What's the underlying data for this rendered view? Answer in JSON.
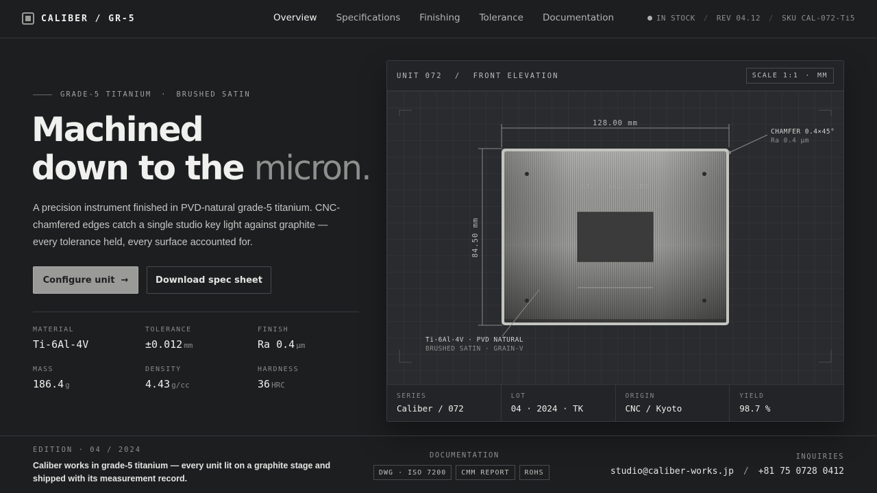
{
  "brand": {
    "name": "CALIBER / GR-5"
  },
  "nav": {
    "links": [
      "Overview",
      "Specifications",
      "Finishing",
      "Tolerance",
      "Documentation"
    ],
    "status": "IN STOCK",
    "sep": "/",
    "rev": "REV 04.12",
    "sku": "SKU CAL-072-Ti5"
  },
  "hero": {
    "eyebrow_a": "GRADE-5 TITANIUM",
    "eyebrow_sep": "·",
    "eyebrow_b": "BRUSHED SATIN",
    "headline_line1": "Machined",
    "headline_line2": "down to the",
    "headline_accent": "micron.",
    "lede": "A precision instrument finished in PVD-natural grade-5 titanium. CNC-chamfered edges catch a single studio key light against graphite — every tolerance held, every surface accounted for.",
    "cta_primary": "Configure unit  →",
    "cta_secondary": "Download spec sheet"
  },
  "specs": [
    {
      "label": "MATERIAL",
      "value": "Ti-6Al-4V",
      "unit": ""
    },
    {
      "label": "TOLERANCE",
      "value": "±0.012",
      "unit": "mm"
    },
    {
      "label": "FINISH",
      "value": "Ra 0.4",
      "unit": "µm"
    },
    {
      "label": "MASS",
      "value": "186.4",
      "unit": "g"
    },
    {
      "label": "DENSITY",
      "value": "4.43",
      "unit": "g/cc"
    },
    {
      "label": "HARDNESS",
      "value": "36",
      "unit": "HRC"
    }
  ],
  "panel": {
    "unit": "UNIT 072",
    "sep": "/",
    "view": "FRONT ELEVATION",
    "scale": "SCALE 1:1",
    "scale_sep": "·",
    "scale_unit": "MM",
    "drawing": {
      "width_dim": "128.00 mm",
      "height_dim": "84.50 mm",
      "chamfer": "CHAMFER 0.4×45°",
      "chamfer_sub": "Ra 0.4 µm",
      "engraving": "CAL · 072 · GR5",
      "material_note": "Ti-6Al-4V · PVD NATURAL",
      "material_sub": "BRUSHED SATIN · GRAIN-V"
    },
    "metrics": [
      {
        "label": "SERIES",
        "value": "Caliber / 072"
      },
      {
        "label": "LOT",
        "value": "04 · 2024 · TK"
      },
      {
        "label": "ORIGIN",
        "value": "CNC / Kyoto"
      },
      {
        "label": "YIELD",
        "value": "98.7 %"
      }
    ]
  },
  "footer": {
    "edition": "EDITION · 04 / 2024",
    "blurb": "Caliber works in grade-5 titanium — every unit lit on a graphite stage and shipped with its measurement record.",
    "doc_label": "DOCUMENTATION",
    "docs": [
      "DWG · ISO 7200",
      "CMM REPORT",
      "ROHS"
    ],
    "inquiries_label": "INQUIRIES",
    "email": "studio@caliber-works.jp",
    "contact_sep": "/",
    "phone": "+81 75 0728 0412"
  }
}
